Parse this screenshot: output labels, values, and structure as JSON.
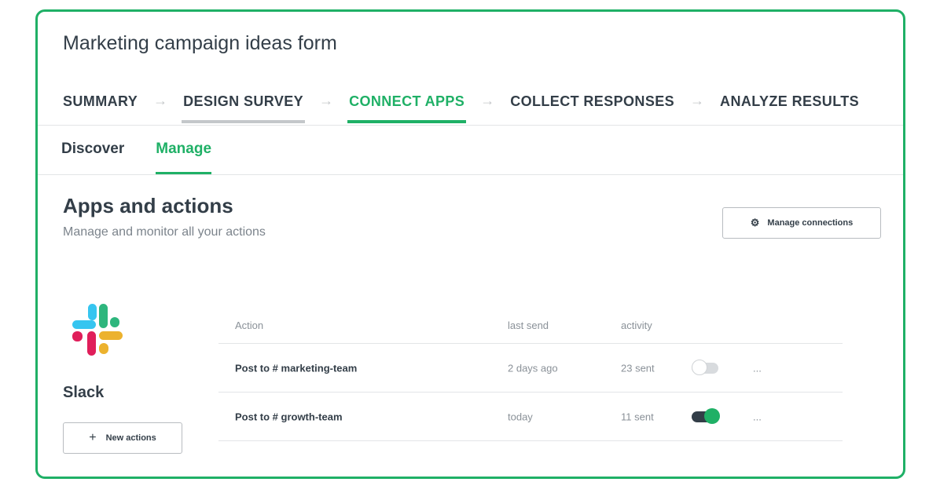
{
  "form": {
    "title": "Marketing campaign ideas form"
  },
  "steps": [
    {
      "label": "SUMMARY",
      "state": "plain"
    },
    {
      "label": "DESIGN SURVEY",
      "state": "done"
    },
    {
      "label": "CONNECT APPS",
      "state": "active"
    },
    {
      "label": "COLLECT RESPONSES",
      "state": "plain"
    },
    {
      "label": "ANALYZE RESULTS",
      "state": "plain"
    }
  ],
  "subtabs": [
    {
      "label": "Discover",
      "active": false
    },
    {
      "label": "Manage",
      "active": true
    }
  ],
  "section": {
    "title": "Apps and actions",
    "subtitle": "Manage and monitor all your actions"
  },
  "toolbar": {
    "manage_connections_label": "Manage connections"
  },
  "app": {
    "name": "Slack",
    "logo_icon": "slack-logo-icon",
    "new_actions_label": "New actions"
  },
  "table": {
    "headers": {
      "action": "Action",
      "last_send": "last send",
      "activity": "activity"
    },
    "rows": [
      {
        "action": "Post to # marketing-team",
        "last_send": "2 days ago",
        "activity": "23 sent",
        "enabled": false,
        "more": "..."
      },
      {
        "action": "Post to # growth-team",
        "last_send": "today",
        "activity": "11 sent",
        "enabled": true,
        "more": "..."
      }
    ]
  },
  "colors": {
    "accent": "#1fb066",
    "text": "#333e48",
    "muted": "#8a9198",
    "slack_blue": "#36c5f0",
    "slack_green": "#2eb67d",
    "slack_red": "#e01e5a",
    "slack_yellow": "#ecb22e"
  }
}
